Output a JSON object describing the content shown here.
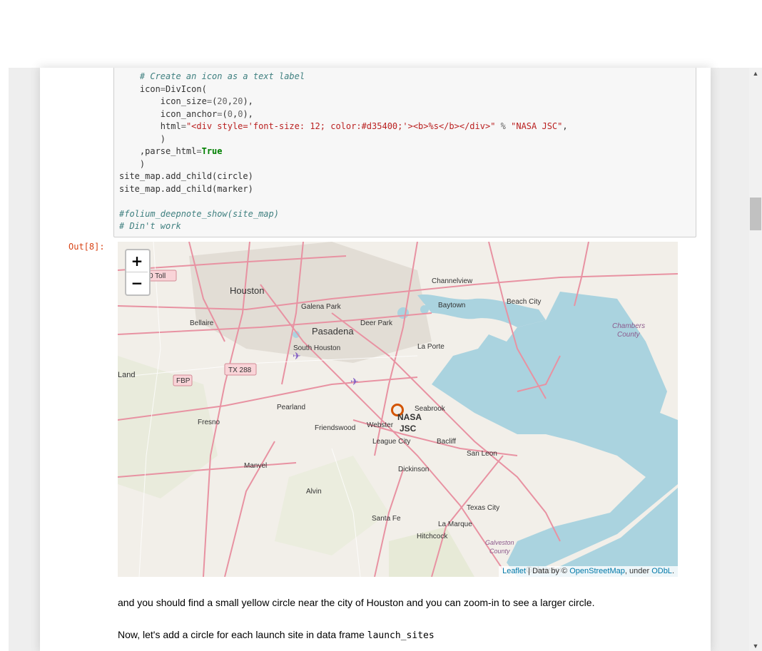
{
  "code_cell": {
    "lines": [
      {
        "parts": [
          {
            "t": "    "
          },
          {
            "t": "# Create an icon as a text label",
            "c": "c-cm"
          }
        ]
      },
      {
        "parts": [
          {
            "t": "    icon"
          },
          {
            "t": "=",
            "c": "c-op"
          },
          {
            "t": "DivIcon("
          }
        ]
      },
      {
        "parts": [
          {
            "t": "        icon_size"
          },
          {
            "t": "=",
            "c": "c-op"
          },
          {
            "t": "("
          },
          {
            "t": "20",
            "c": "c-op"
          },
          {
            "t": ","
          },
          {
            "t": "20",
            "c": "c-op"
          },
          {
            "t": "),"
          }
        ]
      },
      {
        "parts": [
          {
            "t": "        icon_anchor"
          },
          {
            "t": "=",
            "c": "c-op"
          },
          {
            "t": "("
          },
          {
            "t": "0",
            "c": "c-op"
          },
          {
            "t": ","
          },
          {
            "t": "0",
            "c": "c-op"
          },
          {
            "t": "),"
          }
        ]
      },
      {
        "parts": [
          {
            "t": "        html"
          },
          {
            "t": "=",
            "c": "c-op"
          },
          {
            "t": "\"<div style='font-size: 12; color:#d35400;'><b>%s</b></div>\"",
            "c": "c-str"
          },
          {
            "t": " "
          },
          {
            "t": "%",
            "c": "c-op"
          },
          {
            "t": " "
          },
          {
            "t": "\"NASA JSC\"",
            "c": "c-str"
          },
          {
            "t": ","
          }
        ]
      },
      {
        "parts": [
          {
            "t": "        )"
          }
        ]
      },
      {
        "parts": [
          {
            "t": "    ,parse_html"
          },
          {
            "t": "=",
            "c": "c-op"
          },
          {
            "t": "True",
            "c": "c-kw"
          }
        ]
      },
      {
        "parts": [
          {
            "t": "    )"
          }
        ]
      },
      {
        "parts": [
          {
            "t": "site_map.add_child(circle)"
          }
        ]
      },
      {
        "parts": [
          {
            "t": "site_map.add_child(marker)"
          }
        ]
      },
      {
        "parts": [
          {
            "t": ""
          }
        ]
      },
      {
        "parts": [
          {
            "t": "#folium_deepnote_show(site_map)",
            "c": "c-cm"
          }
        ]
      },
      {
        "parts": [
          {
            "t": "# Din't work",
            "c": "c-cm"
          }
        ]
      }
    ]
  },
  "output_prompt": "Out[8]:",
  "map": {
    "zoom_in": "+",
    "zoom_out": "−",
    "attribution": {
      "leaflet": "Leaflet",
      "sep": " | Data by © ",
      "osm": "OpenStreetMap",
      "under": ", under ",
      "odbl": "ODbL",
      "end": "."
    },
    "marker_label_line1": "NASA",
    "marker_label_line2": "JSC",
    "marker_color": "#d35400",
    "water_color": "#aad3df",
    "road_color": "#e892a2",
    "labels": {
      "houston": "Houston",
      "pasadena": "Pasadena",
      "channelview": "Channelview",
      "galena_park": "Galena Park",
      "baytown": "Baytown",
      "beach_city": "Beach City",
      "chambers": "Chambers",
      "county": "County",
      "bellaire": "Bellaire",
      "deer_park": "Deer Park",
      "south_houston": "South Houston",
      "la_porte": "La Porte",
      "land": "Land",
      "tx288": "TX 288",
      "fbp": "FBP",
      "toll": "0 Toll",
      "pearland": "Pearland",
      "seabrook": "Seabrook",
      "fresno": "Fresno",
      "friendswood": "Friendswood",
      "webster": "Webster",
      "league_city": "League City",
      "bacliff": "Bacliff",
      "san_leon": "San Leon",
      "manvel": "Manvel",
      "dickinson": "Dickinson",
      "alvin": "Alvin",
      "texas_city": "Texas City",
      "santa_fe": "Santa Fe",
      "la_marque": "La Marque",
      "hitchcock": "Hitchcock",
      "galveston_county1": "Galveston",
      "galveston_county2": "County",
      "galveston": "Galveston"
    }
  },
  "markdown": {
    "p1": "and you should find a small yellow circle near the city of Houston and you can zoom-in to see a larger circle.",
    "p2_text": "Now, let's add a circle for each launch site in data frame ",
    "p2_code": "launch_sites"
  },
  "scrollbar": {
    "up": "▲",
    "down": "▼"
  }
}
